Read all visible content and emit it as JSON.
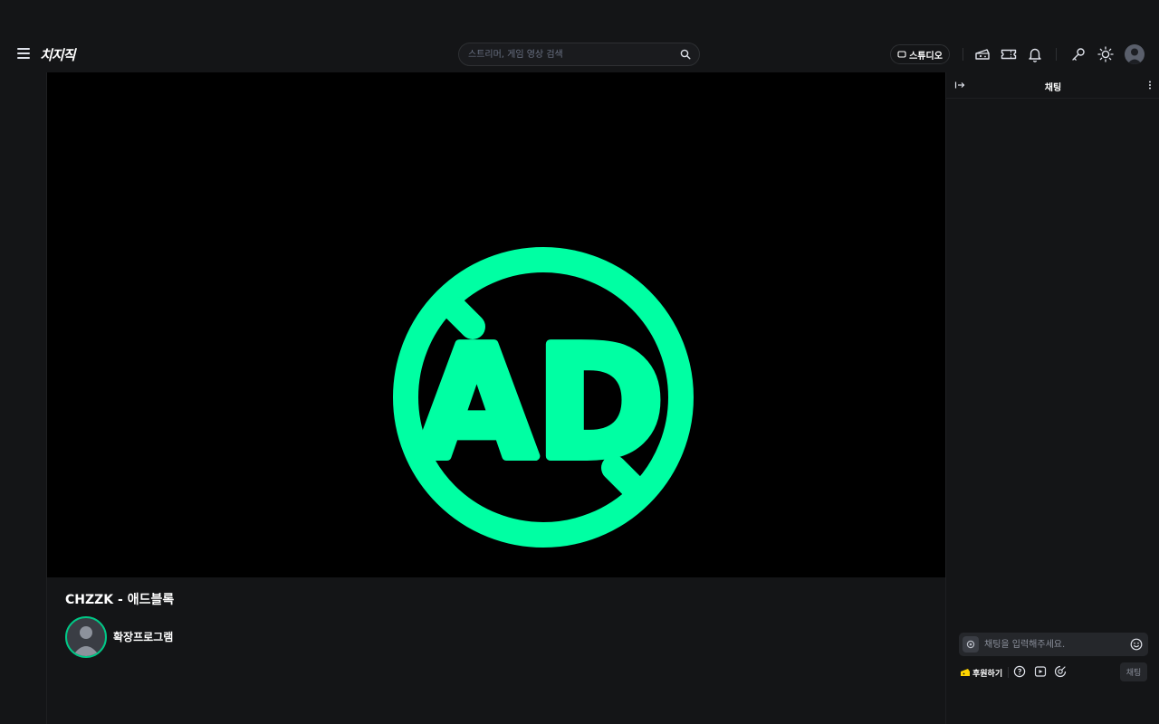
{
  "header": {
    "logo_text": "치지직",
    "search_placeholder": "스트리머, 게임 영상 검색",
    "studio_label": "스튜디오"
  },
  "player": {
    "ad_text": "AD"
  },
  "video": {
    "title": "CHZZK - 애드블록",
    "channel_name": "확장프로그램"
  },
  "chat": {
    "title": "채팅",
    "input_placeholder": "채팅을 입력해주세요.",
    "donate_label": "후원하기",
    "send_label": "채팅"
  },
  "colors": {
    "accent": "#00FFA3",
    "background": "#141517",
    "player_bg": "#000000"
  }
}
